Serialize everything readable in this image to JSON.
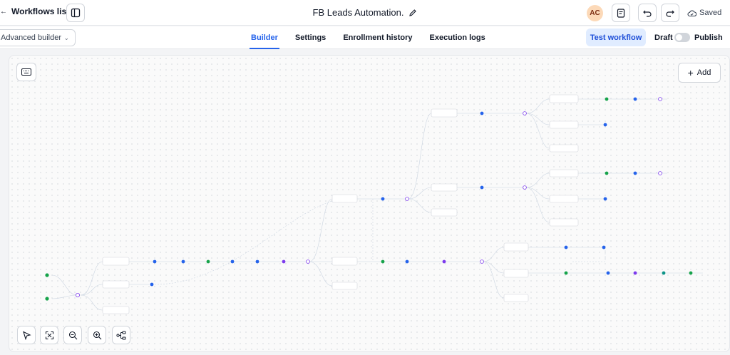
{
  "header": {
    "back_label": "Workflows list",
    "workflow_title": "FB Leads Automation.",
    "avatar_initials": "AC",
    "save_status": "Saved"
  },
  "subheader": {
    "builder_mode": "Advanced builder",
    "tabs": [
      {
        "label": "Builder",
        "active": true
      },
      {
        "label": "Settings",
        "active": false
      },
      {
        "label": "Enrollment history",
        "active": false
      },
      {
        "label": "Execution logs",
        "active": false
      }
    ],
    "test_workflow_label": "Test workflow",
    "draft_label": "Draft",
    "publish_label": "Publish",
    "published": false
  },
  "canvas": {
    "add_label": "Add",
    "controls": [
      "pointer-icon",
      "fit-view-icon",
      "zoom-out-icon",
      "zoom-in-icon",
      "auto-layout-icon"
    ]
  },
  "colors": {
    "accent": "#2563eb",
    "node_green": "#16a34a",
    "node_blue": "#2563eb",
    "node_purple": "#7c3aed",
    "node_teal": "#0d9488"
  }
}
